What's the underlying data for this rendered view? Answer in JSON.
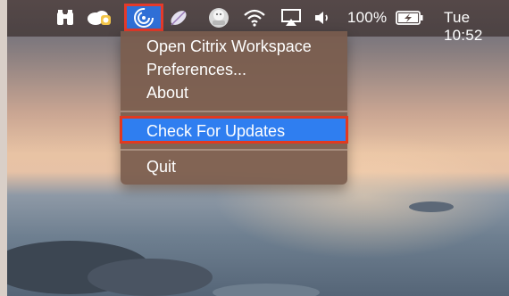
{
  "menubar": {
    "battery_percent": "100%",
    "clock": "Tue 10:52",
    "icons": [
      "binoculars-icon",
      "onedrive-cloud-icon",
      "citrix-workspace-icon",
      "feather-icon",
      "blob-face-icon",
      "wifi-icon",
      "airplay-icon",
      "volume-icon",
      "battery-charging-icon"
    ]
  },
  "menu": {
    "items": [
      {
        "label": "Open Citrix Workspace"
      },
      {
        "label": "Preferences..."
      },
      {
        "label": "About"
      },
      {
        "label": "Check For Updates"
      },
      {
        "label": "Quit"
      }
    ],
    "highlighted_index": 3
  },
  "colors": {
    "highlight": "#2f7ef0",
    "annotation_border": "#e2391f",
    "menu_background": "#7a5c4e"
  }
}
